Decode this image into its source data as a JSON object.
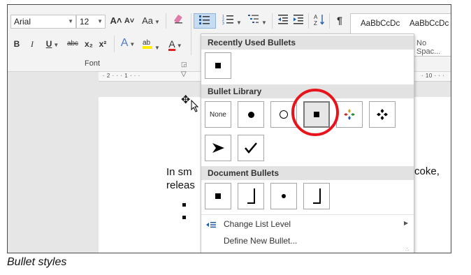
{
  "ribbon": {
    "font_name": "Arial",
    "font_size": "12",
    "grow_font": "A˄",
    "shrink_font": "A˅",
    "change_case": "Aa",
    "bold": "B",
    "italic": "I",
    "underline": "U",
    "strikethrough": "abc",
    "subscript": "x₂",
    "superscript": "x²",
    "text_effects": "A",
    "font_color": "A",
    "font_group_label": "Font",
    "font_color_hex": "#e02020",
    "highlight_color_hex": "#ffee00",
    "styles": [
      {
        "sample": "AaBbCcDc",
        "name": ""
      },
      {
        "sample": "AaBbCcDc",
        "name": "No Spac..."
      }
    ]
  },
  "ruler": {
    "left_marks": "· 2 · · · 1 · · ·",
    "right_marks": "· 10 · · ·"
  },
  "document": {
    "line1_left": "In sm",
    "line2_left": "releas",
    "line1_right": "as coke,"
  },
  "dropdown": {
    "recently_used_header": "Recently Used Bullets",
    "library_header": "Bullet Library",
    "none_label": "None",
    "document_bullets_header": "Document Bullets",
    "change_list_level": "Change List Level",
    "define_new_bullet": "Define New Bullet..."
  },
  "highlight_circle_color": "#e8141c",
  "caption": "Bullet styles"
}
